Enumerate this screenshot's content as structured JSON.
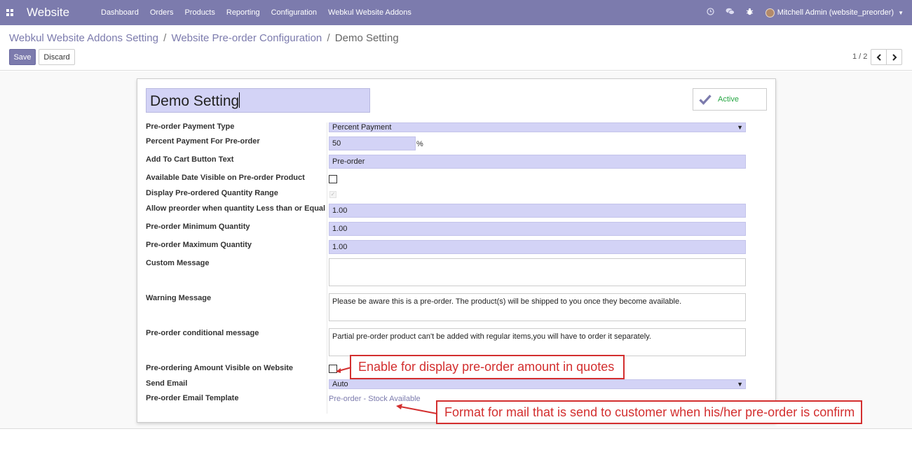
{
  "navbar": {
    "brand": "Website",
    "menu": [
      "Dashboard",
      "Orders",
      "Products",
      "Reporting",
      "Configuration",
      "Webkul Website Addons"
    ],
    "user": "Mitchell Admin (website_preorder)"
  },
  "breadcrumb": {
    "level1": "Webkul Website Addons Setting",
    "level2": "Website Pre-order Configuration",
    "current": "Demo Setting",
    "sep": "/"
  },
  "buttons": {
    "save": "Save",
    "discard": "Discard"
  },
  "pager": {
    "value": "1 / 2"
  },
  "form": {
    "name": "Demo Setting",
    "active_label": "Active",
    "labels": {
      "payment_type": "Pre-order Payment Type",
      "percent_payment": "Percent Payment For Pre-order",
      "cart_text": "Add To Cart Button Text",
      "available_date": "Available Date Visible on Pre-order Product",
      "qty_range": "Display Pre-ordered Quantity Range",
      "allow_less": "Allow preorder when quantity Less than or Equal",
      "min_qty": "Pre-order Minimum Quantity",
      "max_qty": "Pre-order Maximum Quantity",
      "custom_msg": "Custom Message",
      "warning_msg": "Warning Message",
      "cond_msg": "Pre-order conditional message",
      "amount_visible": "Pre-ordering Amount Visible on Website",
      "send_email": "Send Email",
      "email_template": "Pre-order Email Template"
    },
    "values": {
      "payment_type": "Percent Payment",
      "percent_payment": "50",
      "percent_sign": "%",
      "cart_text": "Pre-order",
      "allow_less": "1.00",
      "min_qty": "1.00",
      "max_qty": "1.00",
      "custom_msg": "",
      "warning_msg": "Please be aware this is a pre-order. The product(s) will be shipped to you once they become available.",
      "cond_msg": "Partial pre-order product can't be added with regular items,you will have to order it separately.",
      "send_email": "Auto",
      "email_template": "Pre-order - Stock Available"
    }
  },
  "annotations": {
    "amount": "Enable for display pre-order amount in quotes",
    "mail": "Format for mail that is send to customer when his/her pre-order is confirm"
  }
}
